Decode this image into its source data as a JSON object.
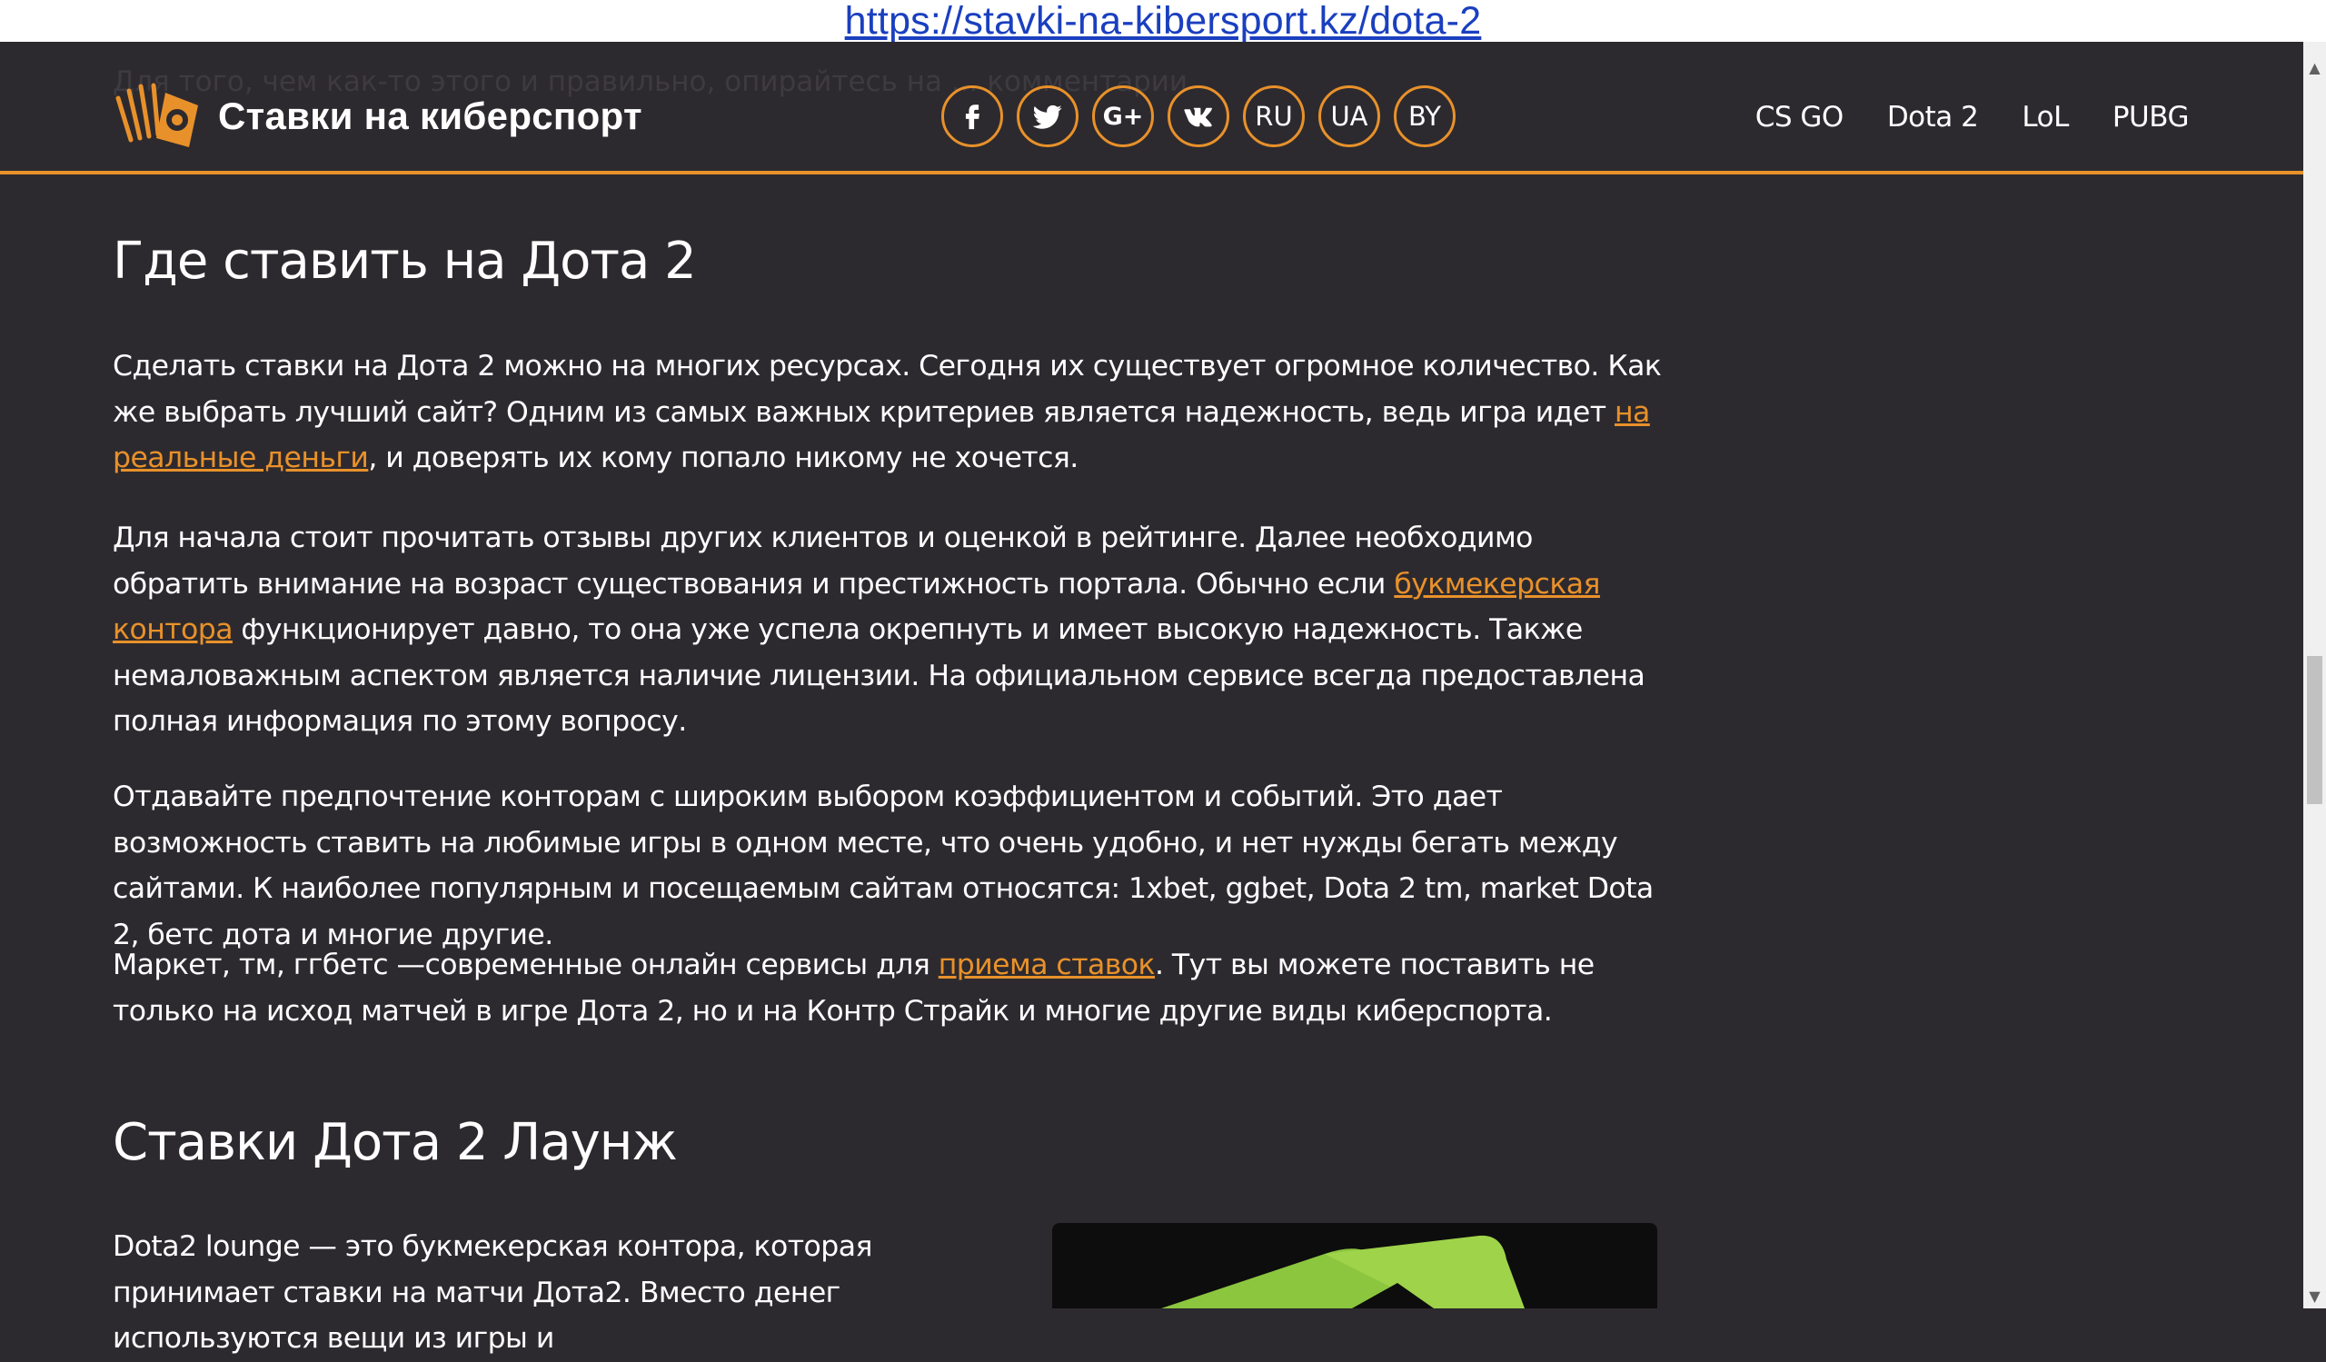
{
  "url": "https://stavki-na-kibersport.kz/dota-2",
  "header": {
    "ghost_text": "Для того, чем как-то этого и правильно, опирайтесь на ... комментарии",
    "logo_text": "Ставки на киберспорт",
    "socials": [
      {
        "name": "facebook-icon"
      },
      {
        "name": "twitter-icon"
      },
      {
        "name": "google-plus-icon",
        "label": "G+"
      },
      {
        "name": "vk-icon"
      }
    ],
    "languages": [
      "RU",
      "UA",
      "BY"
    ],
    "nav": [
      "CS GO",
      "Dota 2",
      "LoL",
      "PUBG"
    ]
  },
  "article": {
    "section1_title": "Где ставить на Дота 2",
    "p1": {
      "before": "Сделать ставки на Дота 2 можно на многих ресурсах. Сегодня их существует огромное количество. Как же выбрать лучший сайт? Одним из самых важных критериев является надежность, ведь игра идет ",
      "link": "на реальные деньги",
      "after": ", и доверять их кому попало никому не хочется."
    },
    "p2": {
      "before": "Для начала стоит прочитать отзывы других клиентов и оценкой в рейтинге. Далее необходимо обратить внимание на возраст существования и престижность портала. Обычно если ",
      "link": "букмекерская контора",
      "after": " функционирует давно, то она уже успела окрепнуть и имеет высокую надежность. Также немаловажным аспектом является наличие лицензии. На официальном сервисе всегда предоставлена полная информация по этому вопросу."
    },
    "p3": "Отдавайте предпочтение конторам с широким выбором коэффициентом и событий. Это дает возможность ставить на любимые игры в одном месте, что очень удобно, и нет нужды бегать между сайтами. К наиболее популярным и посещаемым сайтам относятся: 1xbet, ggbet, Dota 2 tm, market Dota 2, бетс дота и многие другие.",
    "p4": {
      "before": "Маркет, тм, ггбетс —современные онлайн сервисы для ",
      "link": "приема ставок",
      "after": ". Тут вы можете поставить не только на исход матчей в игре Дота 2, но и на Контр Страйк и многие другие виды киберспорта."
    },
    "section2_title": "Ставки Дота 2 Лаунж",
    "p5": "Dota2 lounge — это букмекерская контора, которая принимает ставки на матчи Дота2. Вместо денег используются вещи из игры и"
  },
  "colors": {
    "background": "#2d2a2f",
    "accent": "#e8912a",
    "text": "#ffffff",
    "url_link": "#1a3fbf"
  }
}
